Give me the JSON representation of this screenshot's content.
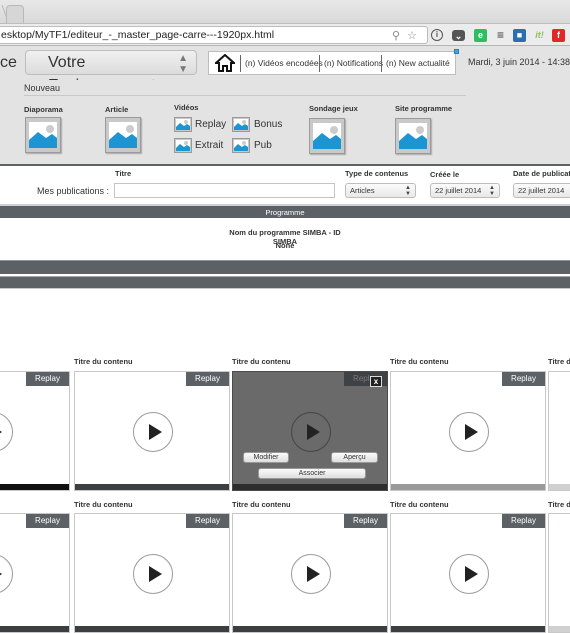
{
  "browser": {
    "url": "esktop/MyTF1/editeur_-_master_page-carre---1920px.html",
    "extensions": [
      "zoom-icon",
      "star-icon",
      "info-icon",
      "pocket-icon",
      "evernote-icon",
      "buffer-icon",
      "extension-icon",
      "scoop-it-icon",
      "flipboard-icon"
    ]
  },
  "header": {
    "left_text": "ce",
    "environment": "Votre Environnement",
    "links": [
      "(n) Vidéos encodées",
      "(n) Notifications",
      "(n) New actualité"
    ],
    "date": "Mardi, 3 juin 2014 - 14:38"
  },
  "nouveau": {
    "title": "Nouveau",
    "items": [
      {
        "label": "Diaporama"
      },
      {
        "label": "Article"
      },
      {
        "label": "Sondage jeux"
      },
      {
        "label": "Site programme"
      }
    ],
    "videos": {
      "label": "Vidéos",
      "types": [
        "Replay",
        "Bonus",
        "Extrait",
        "Pub"
      ]
    }
  },
  "filters": {
    "headers": {
      "titre": "Titre",
      "type": "Type de contenus",
      "created": "Créée le",
      "published": "Date de publicat"
    },
    "mes_publications": "Mes publications :",
    "title_value": "",
    "type_value": "Articles",
    "created_value": "22 juillet 2014",
    "published_value": "22 juillet 2014"
  },
  "programme": {
    "bar_label": "Programme",
    "name_line": "Nom du programme SIMBA - ID",
    "simba": "SIMBA",
    "none": "None"
  },
  "cards": {
    "row1": [
      {
        "title": "",
        "badge": "Replay"
      },
      {
        "title": "Titre du contenu",
        "badge": "Replay"
      },
      {
        "title": "Titre du contenu",
        "badge": "Replay",
        "hover": true
      },
      {
        "title": "Titre du contenu",
        "badge": "Replay"
      },
      {
        "title": "Titre d",
        "badge": ""
      }
    ],
    "row2": [
      {
        "title": "",
        "badge": "Replay"
      },
      {
        "title": "Titre du contenu",
        "badge": "Replay"
      },
      {
        "title": "Titre du contenu",
        "badge": "Replay"
      },
      {
        "title": "Titre du contenu",
        "badge": "Replay"
      },
      {
        "title": "Titre d",
        "badge": ""
      }
    ],
    "hover_actions": {
      "close": "x",
      "modify": "Modifier",
      "preview": "Aperçu",
      "associate": "Associer"
    }
  }
}
